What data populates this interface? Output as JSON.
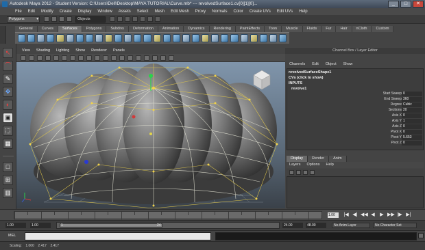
{
  "window": {
    "title": "Autodesk Maya 2012 - Student Version: C:\\Users\\Dell\\Desktop\\MAYA TUTORIAL\\Curve.mb*   ---   revolvedSurface1.cv[0][1][0]...",
    "controls": [
      "_",
      "□",
      "✕"
    ]
  },
  "menubar": [
    "File",
    "Edit",
    "Modify",
    "Create",
    "Display",
    "Window",
    "Assets",
    "Select",
    "Mesh",
    "Edit Mesh",
    "Proxy",
    "Normals",
    "Color",
    "Create UVs",
    "Edit UVs",
    "Help"
  ],
  "statusline": {
    "mode": "Polygons",
    "objects_field": "Objects"
  },
  "shelf": {
    "tabs": [
      "General",
      "Curves",
      "Surfaces",
      "Polygons",
      "Subdivs",
      "Deformation",
      "Animation",
      "Dynamics",
      "Rendering",
      "PaintEffects",
      "Toon",
      "Muscle",
      "Fluids",
      "Fur",
      "Hair",
      "nCloth",
      "Custom"
    ],
    "active_tab": "Surfaces"
  },
  "viewport": {
    "menu": [
      "View",
      "Shading",
      "Lighting",
      "Show",
      "Renderer",
      "Panels"
    ]
  },
  "channel_box": {
    "title": "Channel Box / Layer Editor",
    "menu": [
      "Channels",
      "Edit",
      "Object",
      "Show"
    ],
    "shape_name": "revolvedSurfaceShape1",
    "cv_hint": "CVs (click to show)",
    "inputs_label": "INPUTS",
    "input_node": "revolve1",
    "attributes": [
      {
        "label": "Start Sweep",
        "value": "0"
      },
      {
        "label": "End Sweep",
        "value": "360"
      },
      {
        "label": "Degree",
        "value": "Cubic"
      },
      {
        "label": "Sections",
        "value": "20"
      },
      {
        "label": "Axis X",
        "value": "0"
      },
      {
        "label": "Axis Y",
        "value": "1"
      },
      {
        "label": "Axis Z",
        "value": "0"
      },
      {
        "label": "Pivot X",
        "value": "0"
      },
      {
        "label": "Pivot Y",
        "value": "5.653"
      },
      {
        "label": "Pivot Z",
        "value": "0"
      }
    ]
  },
  "layer_editor": {
    "tabs": [
      "Display",
      "Render",
      "Anim"
    ],
    "active_tab": "Display",
    "menu": [
      "Layers",
      "Options",
      "Help"
    ]
  },
  "time_slider": {
    "current_frame": "1.00",
    "play_controls": [
      "|◀",
      "◀|",
      "◀◀",
      "◀",
      "▶",
      "▶▶",
      "|▶",
      "▶|"
    ]
  },
  "range_slider": {
    "start": "1.00",
    "playback_start": "1.00",
    "inner_start": "1",
    "inner_end": "24",
    "playback_end": "24.00",
    "end": "48.00",
    "anim_layer": "No Anim Layer",
    "character_set": "No Character Set"
  },
  "command_line": {
    "label": "MEL"
  },
  "help_line": "Scaling:    1.000    2.417    2.417"
}
